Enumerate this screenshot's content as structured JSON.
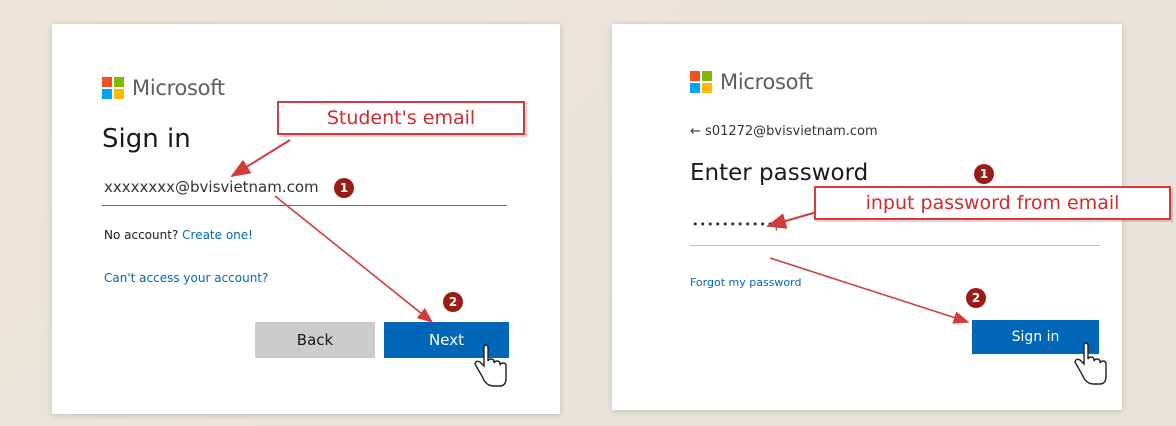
{
  "left_panel": {
    "brand": "Microsoft",
    "title": "Sign in",
    "email_value": "xxxxxxxx@bvisvietnam.com",
    "no_account_text": "No account?",
    "create_link": "Create one!",
    "cant_access_link": "Can't access your account?",
    "back_label": "Back",
    "next_label": "Next",
    "callout": "Student's email",
    "badge_1": "1",
    "badge_2": "2"
  },
  "right_panel": {
    "brand": "Microsoft",
    "back_arrow": "←",
    "email": "s01272@bvisvietnam.com",
    "title": "Enter password",
    "password_value": "•••••••••••|",
    "forgot_link": "Forgot my password",
    "sign_in_label": "Sign in",
    "callout": "input password from email",
    "badge_1": "1",
    "badge_2": "2"
  },
  "colors": {
    "ms_red": "#f25022",
    "ms_green": "#7fba00",
    "ms_blue": "#00a4ef",
    "ms_yellow": "#ffb900",
    "primary_button": "#0067b8",
    "annotation_red": "#d23b3b",
    "badge": "#9b1c14"
  }
}
